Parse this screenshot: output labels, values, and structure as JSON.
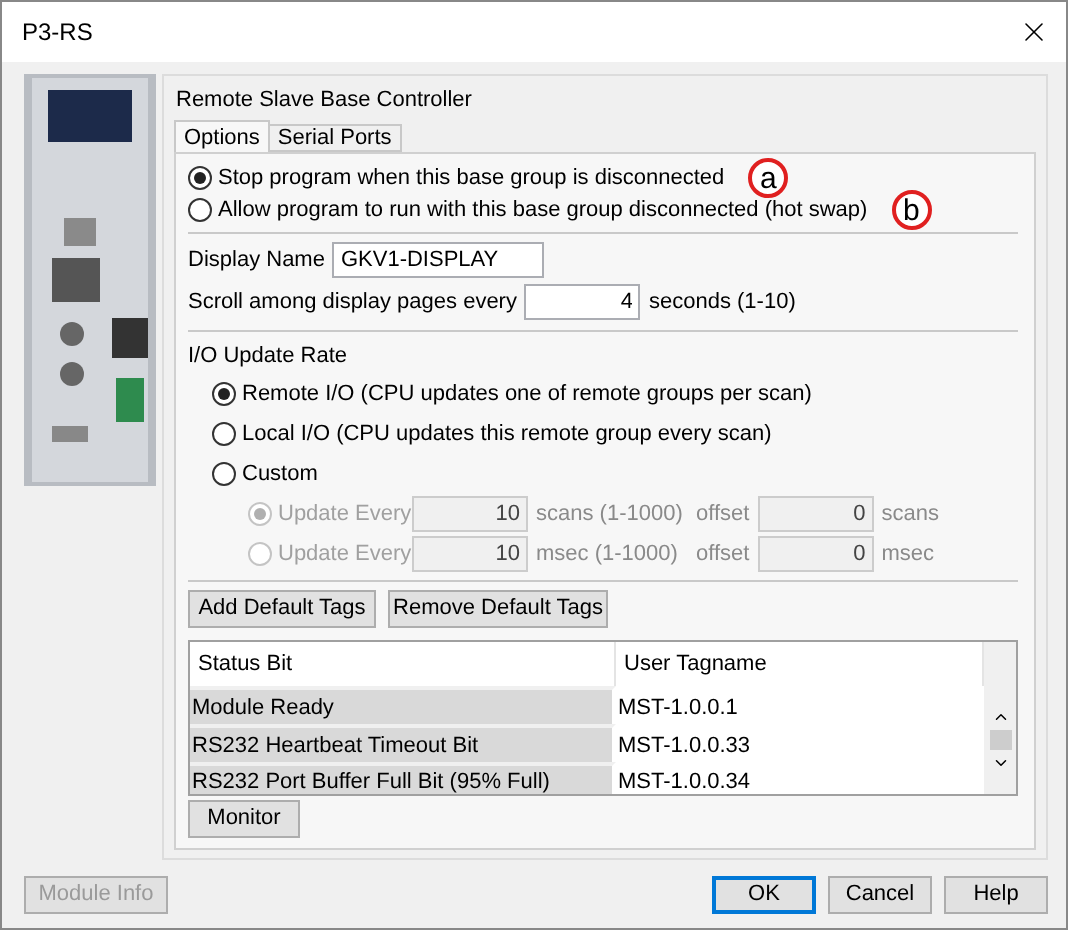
{
  "window": {
    "title": "P3-RS"
  },
  "device": {
    "kind": "picture"
  },
  "panel_title": "Remote Slave Base Controller",
  "tabs": [
    {
      "label": "Options",
      "selected": true
    },
    {
      "label": "Serial Ports",
      "selected": false
    }
  ],
  "disconnect_options": [
    {
      "label": "Stop program when this base group is disconnected",
      "selected": true,
      "callout": "a"
    },
    {
      "label": "Allow program to run with this base group disconnected (hot swap)",
      "selected": false,
      "callout": "b"
    }
  ],
  "display_name": {
    "label": "Display Name",
    "value": "GKV1-DISPLAY"
  },
  "scroll": {
    "label": "Scroll among display pages every",
    "value": "4",
    "unit": "seconds (1-10)"
  },
  "io_update": {
    "title": "I/O Update Rate",
    "options": [
      {
        "label": "Remote I/O (CPU updates one of remote groups per scan)",
        "selected": true
      },
      {
        "label": "Local I/O (CPU updates this remote group every scan)",
        "selected": false
      },
      {
        "label": "Custom",
        "selected": false
      }
    ],
    "custom_rows": [
      {
        "label": "Update Every",
        "selected": true,
        "disabled": true,
        "value": "10",
        "unit": "scans (1-1000)",
        "offset_label": "offset",
        "offset_value": "0",
        "offset_unit": "scans"
      },
      {
        "label": "Update Every",
        "selected": false,
        "disabled": true,
        "value": "10",
        "unit": "msec (1-1000)",
        "offset_label": "offset",
        "offset_value": "0",
        "offset_unit": "msec"
      }
    ]
  },
  "tag_buttons": [
    "Add Default Tags",
    "Remove Default Tags"
  ],
  "table": {
    "columns": [
      "Status Bit",
      "User Tagname"
    ],
    "rows": [
      [
        "Module Ready",
        "MST-1.0.0.1"
      ],
      [
        "RS232 Heartbeat Timeout Bit",
        "MST-1.0.0.33"
      ],
      [
        "RS232 Port Buffer Full Bit (95% Full)",
        "MST-1.0.0.34"
      ]
    ]
  },
  "monitor_button": "Monitor",
  "module_info": {
    "label": "Module Info",
    "disabled": true
  },
  "buttons": [
    {
      "label": "OK",
      "default": true
    },
    {
      "label": "Cancel",
      "default": false
    },
    {
      "label": "Help",
      "default": false
    }
  ]
}
